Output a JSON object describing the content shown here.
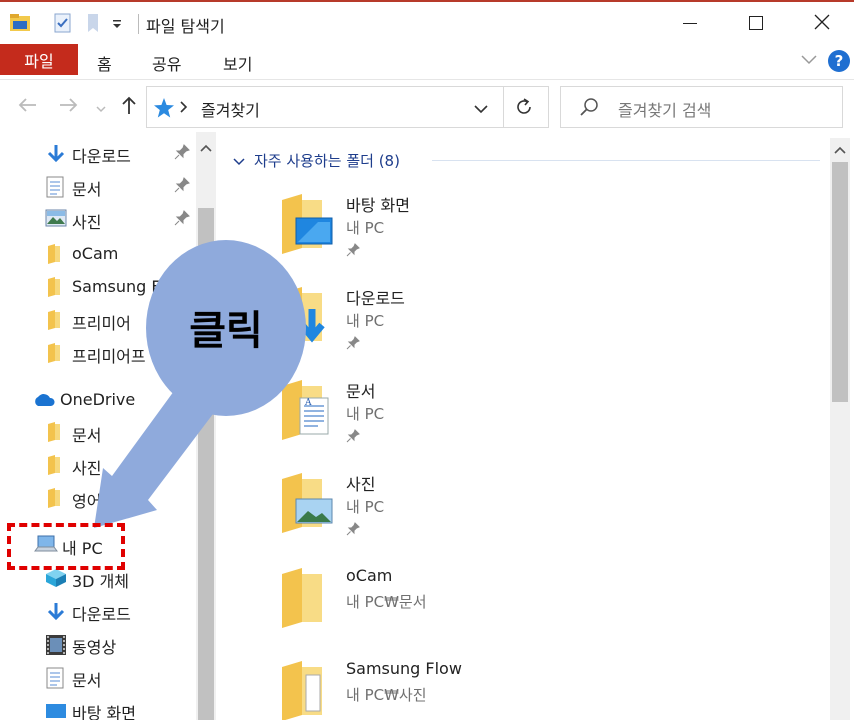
{
  "window": {
    "title": "파일 탐색기",
    "minimize_icon": "minimize-icon",
    "maximize_icon": "maximize-icon",
    "close_icon": "close-icon"
  },
  "ribbon": {
    "tabs": [
      "파일",
      "홈",
      "공유",
      "보기"
    ],
    "active_tab": "파일",
    "accent": "#c42b1c",
    "help_label": "?"
  },
  "address": {
    "path": "즐겨찾기",
    "search_placeholder": "즐겨찾기 검색"
  },
  "sidebar": {
    "quick_access": [
      {
        "label": "다운로드",
        "icon": "download-arrow-icon",
        "pinned": true
      },
      {
        "label": "문서",
        "icon": "document-icon",
        "pinned": true
      },
      {
        "label": "사진",
        "icon": "picture-icon",
        "pinned": true
      },
      {
        "label": "oCam",
        "icon": "folder-icon",
        "pinned": false
      },
      {
        "label": "Samsung Fl",
        "icon": "folder-icon",
        "pinned": false
      },
      {
        "label": "프리미어",
        "icon": "folder-icon",
        "pinned": false
      },
      {
        "label": "프리미어프",
        "icon": "folder-icon",
        "pinned": false
      }
    ],
    "onedrive": {
      "label": "OneDrive",
      "items": [
        "문서",
        "사진",
        "영어"
      ]
    },
    "this_pc": {
      "label": "내 PC",
      "items": [
        {
          "label": "3D 개체",
          "icon": "3d-object-icon"
        },
        {
          "label": "다운로드",
          "icon": "download-arrow-icon"
        },
        {
          "label": "동영상",
          "icon": "video-icon"
        },
        {
          "label": "문서",
          "icon": "document-icon"
        },
        {
          "label": "바탕 화면",
          "icon": "desktop-icon"
        }
      ]
    }
  },
  "main": {
    "section_title": "자주 사용하는 폴더 (8)",
    "folders": [
      {
        "name": "바탕 화면",
        "path": "내 PC",
        "pinned": true,
        "icon": "desktop-folder-icon"
      },
      {
        "name": "다운로드",
        "path": "내 PC",
        "pinned": true,
        "icon": "download-folder-icon"
      },
      {
        "name": "문서",
        "path": "내 PC",
        "pinned": true,
        "icon": "document-folder-icon"
      },
      {
        "name": "사진",
        "path": "내 PC",
        "pinned": true,
        "icon": "picture-folder-icon"
      },
      {
        "name": "oCam",
        "path": "내 PC₩문서",
        "pinned": false,
        "icon": "folder-icon"
      },
      {
        "name": "Samsung Flow",
        "path": "내 PC₩사진",
        "pinned": false,
        "icon": "folder-icon"
      }
    ]
  },
  "annotation": {
    "callout_text": "클릭",
    "callout_color": "#8faadc",
    "highlight_color": "#e00000"
  }
}
